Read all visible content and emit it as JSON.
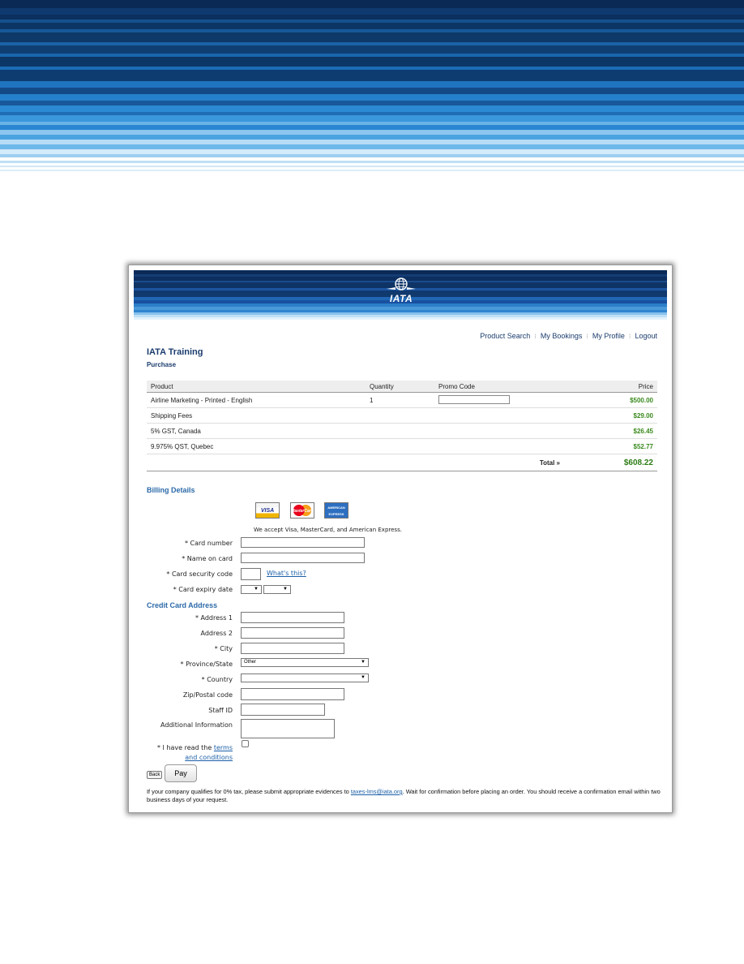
{
  "nav": {
    "items": [
      "Product Search",
      "My Bookings",
      "My Profile",
      "Logout"
    ]
  },
  "header": {
    "logo_text": "IATA",
    "title": "IATA  Training",
    "subtitle": "Purchase"
  },
  "order": {
    "columns": {
      "product": "Product",
      "quantity": "Quantity",
      "promo": "Promo Code",
      "price": "Price"
    },
    "rows": [
      {
        "product": "Airline Marketing - Printed - English",
        "quantity": "1",
        "price": "$500.00"
      },
      {
        "product": "Shipping Fees",
        "quantity": "",
        "price": "$29.00"
      },
      {
        "product": "5% GST, Canada",
        "quantity": "",
        "price": "$26.45"
      },
      {
        "product": "9.975% QST, Quebec",
        "quantity": "",
        "price": "$52.77"
      }
    ],
    "total_label": "Total »",
    "total_value": "$608.22"
  },
  "billing": {
    "title": "Billing Details",
    "cards": {
      "visa": "VISA",
      "mastercard": "MasterCard",
      "amex": "AMERICAN EXPRESS"
    },
    "accept_text": "We accept Visa, MasterCard, and American Express.",
    "card_number_label": "* Card number",
    "name_on_card_label": "* Name on card",
    "security_code_label": "* Card security code",
    "whats_this": "What's this?",
    "expiry_label": "* Card expiry date"
  },
  "address": {
    "title": "Credit Card Address",
    "address1_label": "* Address 1",
    "address2_label": "Address 2",
    "city_label": "* City",
    "province_label": "* Province/State",
    "province_value": "Other",
    "country_label": "* Country",
    "country_value": "",
    "zip_label": "Zip/Postal code",
    "staff_label": "Staff ID",
    "additional_label": "Additional Information",
    "terms_prefix": "* I have read the",
    "terms_link_1": "terms",
    "terms_link_2": "and conditions"
  },
  "actions": {
    "back": "Back",
    "pay": "Pay"
  },
  "footnote": {
    "before": "If your company qualifies for 0% tax, please submit appropriate evidences to ",
    "email": "taxes-lms@iata.org",
    "after": ". Wait for confirmation before placing an order. You should receive a confirmation email within two business days of your request."
  }
}
